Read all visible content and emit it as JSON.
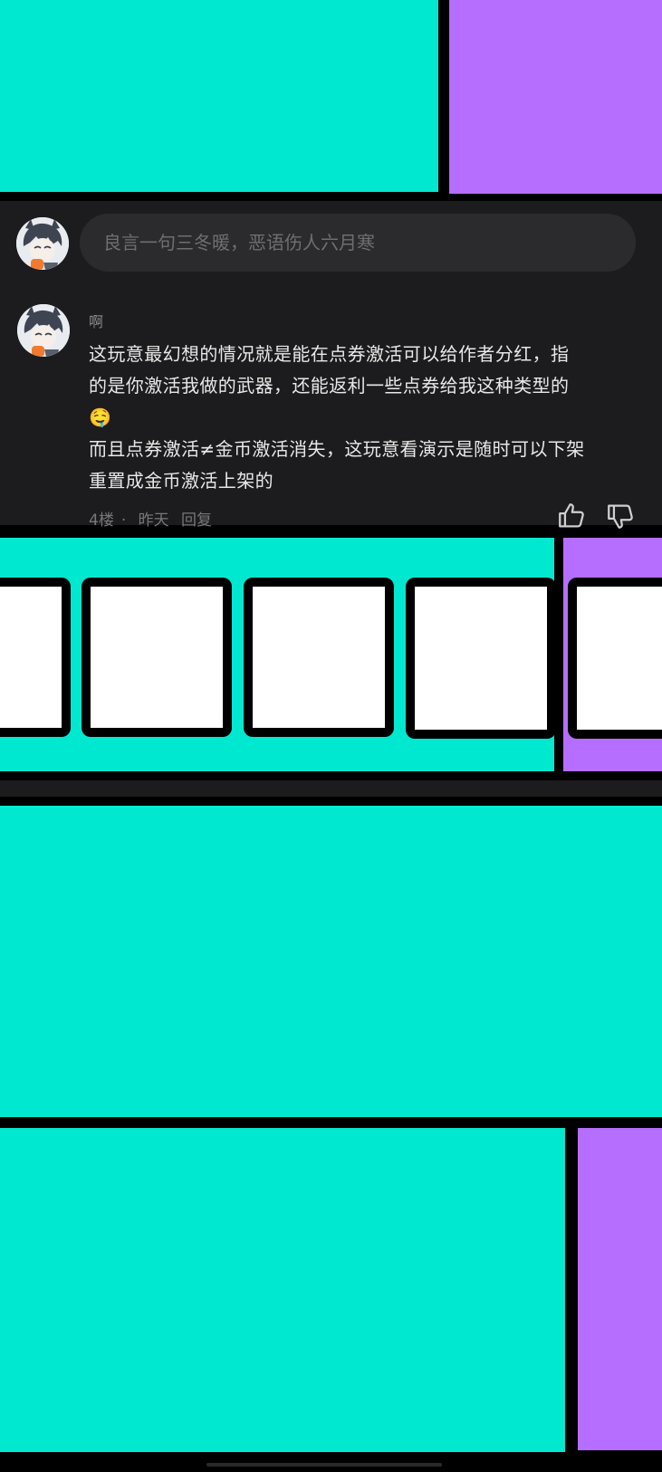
{
  "comment_input": {
    "placeholder": "良言一句三冬暖，恶语伤人六月寒"
  },
  "comment": {
    "username": "啊",
    "lines": [
      "这玩意最幻想的情况就是能在点券激活可以给作者分红，指",
      "的是你激活我做的武器，还能返利一些点券给我这种类型的"
    ],
    "emoji": "🤤",
    "lines2": [
      "而且点券激活≠金币激活消失，这玩意看演示是随时可以下架",
      "重置成金币激活上架的"
    ],
    "floor": "4楼",
    "separator": "·",
    "time": "昨天",
    "reply_label": "回复"
  },
  "icons": {
    "like": "thumbs-up-icon",
    "dislike": "thumbs-down-icon"
  },
  "colors": {
    "teal": "#00e8cf",
    "purple": "#b56eff",
    "panel": "#1c1c1e"
  }
}
